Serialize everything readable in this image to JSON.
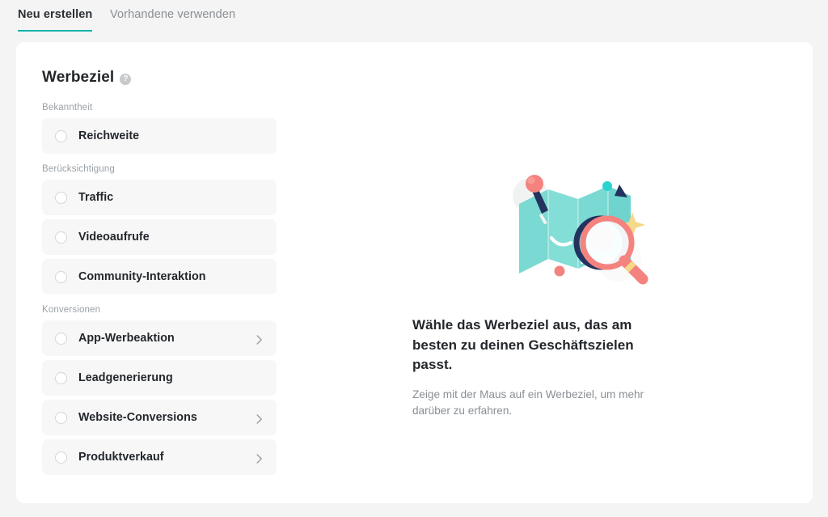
{
  "tabs": [
    {
      "label": "Neu erstellen",
      "active": true,
      "name": "tab-create-new"
    },
    {
      "label": "Vorhandene verwenden",
      "active": false,
      "name": "tab-use-existing"
    }
  ],
  "panel": {
    "title": "Werbeziel",
    "help_icon": "help-circle-icon",
    "help_glyph": "?"
  },
  "groups": [
    {
      "label": "Bekanntheit",
      "options": [
        {
          "label": "Reichweite",
          "has_chevron": false,
          "selected": false
        }
      ]
    },
    {
      "label": "Berücksichtigung",
      "options": [
        {
          "label": "Traffic",
          "has_chevron": false,
          "selected": false
        },
        {
          "label": "Videoaufrufe",
          "has_chevron": false,
          "selected": false
        },
        {
          "label": "Community-Interaktion",
          "has_chevron": false,
          "selected": false
        }
      ]
    },
    {
      "label": "Konversionen",
      "options": [
        {
          "label": "App-Werbeaktion",
          "has_chevron": true,
          "selected": false
        },
        {
          "label": "Leadgenerierung",
          "has_chevron": false,
          "selected": false
        },
        {
          "label": "Website-Conversions",
          "has_chevron": true,
          "selected": false
        },
        {
          "label": "Produktverkauf",
          "has_chevron": true,
          "selected": false
        }
      ]
    }
  ],
  "detail": {
    "illustration": "map-with-magnifier-illustration",
    "heading": "Wähle das Werbeziel aus, das am besten zu deinen Geschäftszielen passt.",
    "subtext": "Zeige mit der Maus auf ein Werbeziel, um mehr darüber zu erfahren."
  },
  "colors": {
    "accent_teal": "#15b3ad",
    "page_background": "#f4f4f4",
    "card_background": "#ffffff",
    "row_background": "#f7f7f8",
    "text_primary": "#23272b",
    "text_muted": "#8a8f94",
    "illustration_map": "#7ad9d2",
    "illustration_coral": "#f4837f",
    "illustration_navy": "#23325e",
    "illustration_gold": "#f5d98b",
    "illustration_cyan": "#2ad2d2"
  }
}
